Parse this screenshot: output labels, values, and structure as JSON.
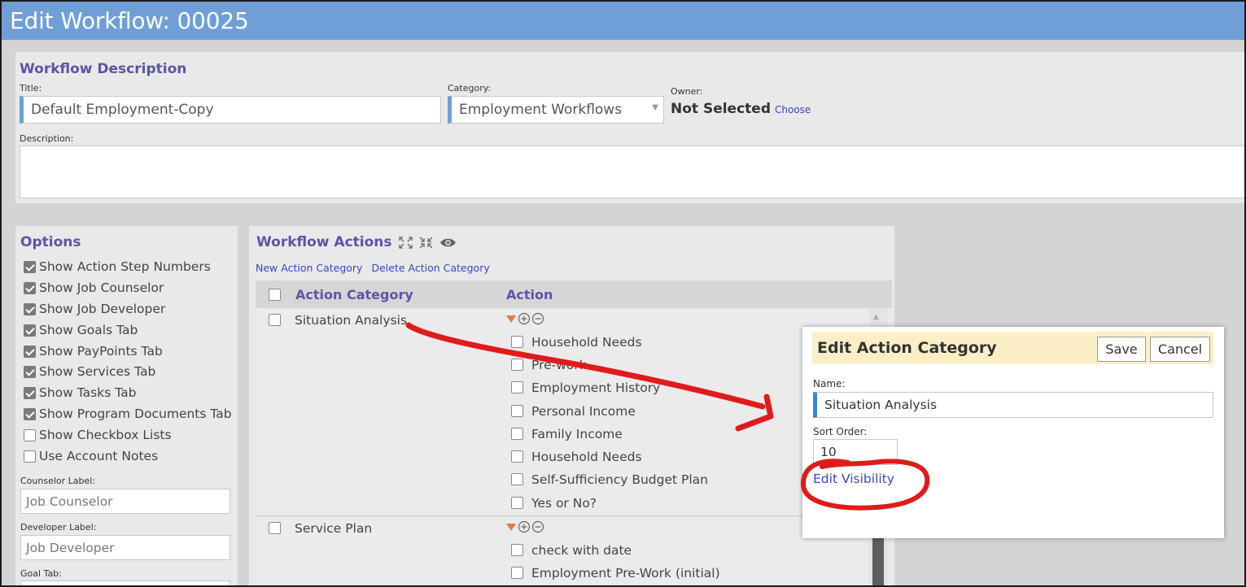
{
  "header": {
    "title": "Edit Workflow: 00025"
  },
  "description": {
    "section_title": "Workflow Description",
    "title_label": "Title:",
    "title_value": "Default Employment-Copy",
    "category_label": "Category:",
    "category_value": "Employment Workflows",
    "owner_label": "Owner:",
    "owner_value": "Not Selected",
    "owner_choose": "Choose",
    "description_label": "Description:",
    "description_value": ""
  },
  "options": {
    "section_title": "Options",
    "items": [
      {
        "label": "Show Action Step Numbers",
        "checked": true
      },
      {
        "label": "Show Job Counselor",
        "checked": true
      },
      {
        "label": "Show Job Developer",
        "checked": true
      },
      {
        "label": "Show Goals Tab",
        "checked": true
      },
      {
        "label": "Show PayPoints Tab",
        "checked": true
      },
      {
        "label": "Show Services Tab",
        "checked": true
      },
      {
        "label": "Show Tasks Tab",
        "checked": true
      },
      {
        "label": "Show Program Documents Tab",
        "checked": true
      },
      {
        "label": "Show Checkbox Lists",
        "checked": false
      },
      {
        "label": "Use Account Notes",
        "checked": false
      }
    ],
    "counselor_label": "Counselor Label:",
    "counselor_value": "Job Counselor",
    "developer_label": "Developer Label:",
    "developer_value": "Job Developer",
    "goal_tab_label": "Goal Tab:"
  },
  "actions": {
    "section_title": "Workflow Actions",
    "expand_icon": "expand-icon",
    "collapse_icon": "collapse-icon",
    "view_icon": "eye-icon",
    "new_category": "New Action Category",
    "delete_category": "Delete Action Category",
    "col_category": "Action Category",
    "col_action": "Action",
    "groups": [
      {
        "category": "Situation Analysis",
        "actions": [
          "Household Needs",
          "Pre-work",
          "Employment History",
          "Personal Income",
          "Family Income",
          "Household Needs",
          "Self-Sufficiency Budget Plan",
          "Yes or No?"
        ]
      },
      {
        "category": "Service Plan",
        "actions": [
          "check with date",
          "Employment Pre-Work (initial)"
        ]
      }
    ]
  },
  "modal": {
    "title": "Edit Action Category",
    "save": "Save",
    "cancel": "Cancel",
    "name_label": "Name:",
    "name_value": "Situation Analysis",
    "sort_label": "Sort Order:",
    "sort_value": "10",
    "edit_visibility": "Edit Visibility"
  },
  "colors": {
    "header": "#6f9fd6",
    "section_title": "#5a55a8",
    "link": "#3a45c8",
    "modal_header": "#fcefc7",
    "annotation": "#e01b1b"
  }
}
